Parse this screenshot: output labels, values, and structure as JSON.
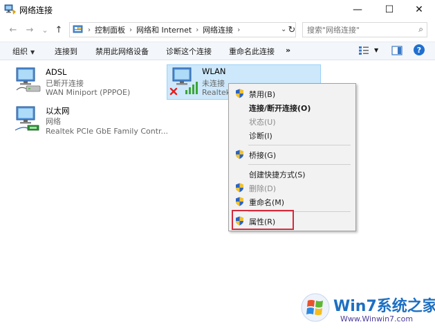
{
  "window": {
    "title": "网络连接",
    "minimize_glyph": "—",
    "maximize_glyph": "☐",
    "close_glyph": "✕"
  },
  "nav": {
    "back_glyph": "←",
    "forward_glyph": "→",
    "recent_glyph": "⌄",
    "up_glyph": "↑",
    "breadcrumb": [
      "控制面板",
      "网络和 Internet",
      "网络连接"
    ],
    "breadcrumb_sep": "›",
    "refresh_glyph": "↻",
    "dropdown_glyph": "⌄",
    "search_placeholder": "搜索\"网络连接\"",
    "search_glyph": "⌕"
  },
  "commandbar": {
    "organize": "组织",
    "caret": "▼",
    "connect": "连接到",
    "disable": "禁用此网络设备",
    "diagnose": "诊断这个连接",
    "rename": "重命名此连接",
    "more": "»",
    "help": "?"
  },
  "connections": [
    {
      "name": "ADSL",
      "status": "已断开连接",
      "device": "WAN Miniport (PPPOE)"
    },
    {
      "name": "WLAN",
      "status": "未连接",
      "device": "Realtek"
    },
    {
      "name": "以太网",
      "status": "网络",
      "device": "Realtek PCIe GbE Family Contr..."
    }
  ],
  "context_menu": {
    "items": [
      {
        "label": "禁用(B)"
      },
      {
        "label": "连接/断开连接(O)"
      },
      {
        "label": "状态(U)"
      },
      {
        "label": "诊断(I)"
      },
      {
        "label": "桥接(G)"
      },
      {
        "label": "创建快捷方式(S)"
      },
      {
        "label": "删除(D)"
      },
      {
        "label": "重命名(M)"
      },
      {
        "label": "属性(R)"
      }
    ]
  },
  "watermark": {
    "title": "Win7系统之家",
    "url": "Www.Winwin7.com"
  },
  "colors": {
    "accent": "#1c6fc2",
    "selection": "#cde8fb",
    "highlight_border": "#d42a3b",
    "menu_bg": "#f2f2f2"
  }
}
